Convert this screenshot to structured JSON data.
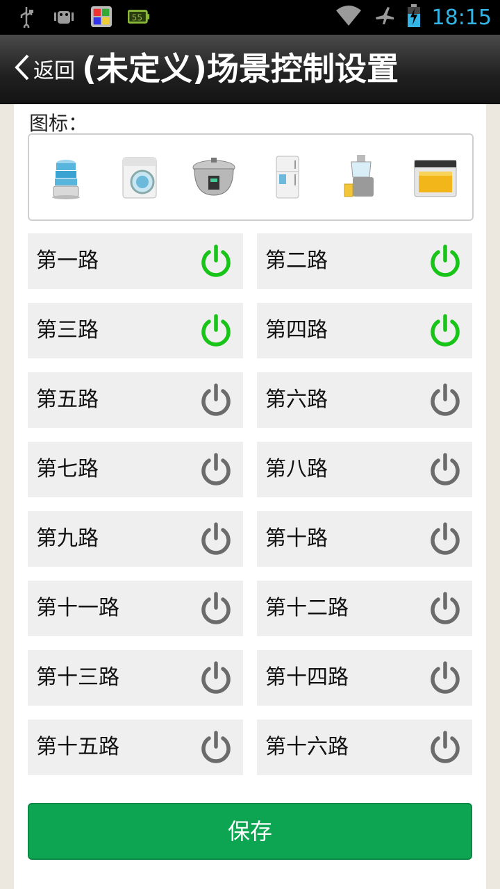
{
  "status_bar": {
    "time": "18:15",
    "icons": [
      "usb-icon",
      "android-debug-icon",
      "app-notification-icon",
      "battery-app-icon",
      "wifi-icon",
      "airplane-mode-icon",
      "battery-charging-icon"
    ]
  },
  "header": {
    "back_label": "返回",
    "title": "(未定义)场景控制设置"
  },
  "icons_section": {
    "label": "图标：",
    "items": [
      "steamer-icon",
      "washing-machine-icon",
      "rice-cooker-icon",
      "refrigerator-icon",
      "juicer-icon",
      "oven-icon"
    ]
  },
  "channels": [
    {
      "label": "第一路",
      "on": true
    },
    {
      "label": "第二路",
      "on": true
    },
    {
      "label": "第三路",
      "on": true
    },
    {
      "label": "第四路",
      "on": true
    },
    {
      "label": "第五路",
      "on": false
    },
    {
      "label": "第六路",
      "on": false
    },
    {
      "label": "第七路",
      "on": false
    },
    {
      "label": "第八路",
      "on": false
    },
    {
      "label": "第九路",
      "on": false
    },
    {
      "label": "第十路",
      "on": false
    },
    {
      "label": "第十一路",
      "on": false
    },
    {
      "label": "第十二路",
      "on": false
    },
    {
      "label": "第十三路",
      "on": false
    },
    {
      "label": "第十四路",
      "on": false
    },
    {
      "label": "第十五路",
      "on": false
    },
    {
      "label": "第十六路",
      "on": false
    }
  ],
  "colors": {
    "power_on": "#19c419",
    "power_off": "#6b6b6b",
    "save_button": "#0ea552",
    "status_accent": "#33b5e5"
  },
  "save_label": "保存"
}
